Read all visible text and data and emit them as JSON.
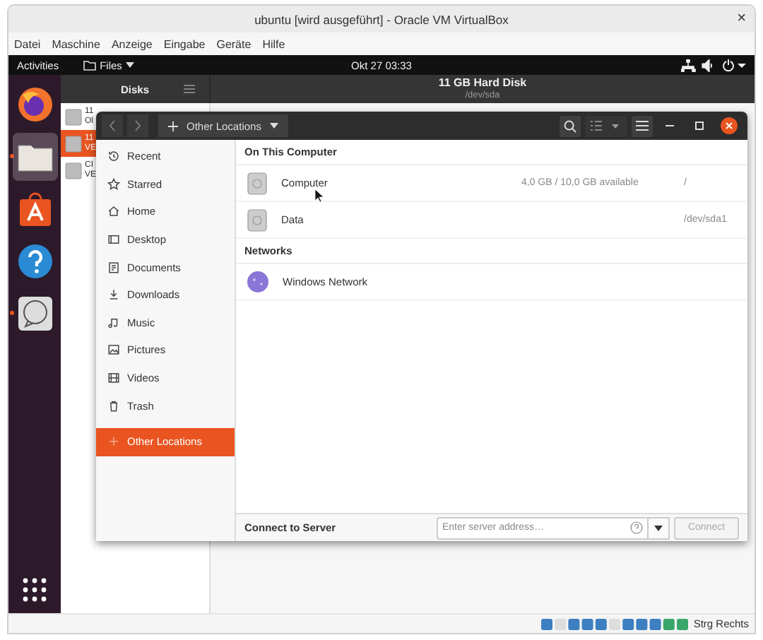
{
  "window": {
    "title": "ubuntu [wird ausgeführt] - Oracle VM VirtualBox",
    "close_glyph": "×"
  },
  "menu": [
    "Datei",
    "Maschine",
    "Anzeige",
    "Eingabe",
    "Geräte",
    "Hilfe"
  ],
  "top_bar": {
    "activities": "Activities",
    "app_menu": "Files",
    "clock": "Okt 27  03:33"
  },
  "dock": [
    {
      "kind": "firefox",
      "running": false,
      "selected": false
    },
    {
      "kind": "files",
      "running": true,
      "selected": true
    },
    {
      "kind": "store",
      "running": false,
      "selected": false
    },
    {
      "kind": "help",
      "running": false,
      "selected": false
    },
    {
      "kind": "chat",
      "running": true,
      "selected": false
    }
  ],
  "disks": {
    "title": "Disks",
    "header_title": "11 GB Hard Disk",
    "header_subtitle": "/dev/sda",
    "items": [
      {
        "title": "11",
        "subtitle": "Ol",
        "selected": false
      },
      {
        "title": "11",
        "subtitle": "VE",
        "selected": true
      },
      {
        "title": "CI",
        "subtitle": "VE",
        "selected": false
      }
    ]
  },
  "files": {
    "location": "Other Locations",
    "sidebar": [
      {
        "label": "Recent",
        "kind": "recent",
        "selected": false
      },
      {
        "label": "Starred",
        "kind": "star",
        "selected": false
      },
      {
        "label": "Home",
        "kind": "home",
        "selected": false
      },
      {
        "label": "Desktop",
        "kind": "desktop",
        "selected": false
      },
      {
        "label": "Documents",
        "kind": "documents",
        "selected": false
      },
      {
        "label": "Downloads",
        "kind": "downloads",
        "selected": false
      },
      {
        "label": "Music",
        "kind": "music",
        "selected": false
      },
      {
        "label": "Pictures",
        "kind": "pictures",
        "selected": false
      },
      {
        "label": "Videos",
        "kind": "videos",
        "selected": false
      },
      {
        "label": "Trash",
        "kind": "trash",
        "selected": false
      },
      {
        "label": "Other Locations",
        "kind": "other",
        "selected": true
      }
    ],
    "sections": [
      {
        "title": "On This Computer",
        "rows": [
          {
            "name": "Computer",
            "kind": "drive",
            "info": "4,0 GB / 10,0 GB available",
            "path": "/"
          },
          {
            "name": "Data",
            "kind": "drive",
            "path": "/dev/sda1"
          }
        ]
      },
      {
        "title": "Networks",
        "rows": [
          {
            "name": "Windows Network",
            "kind": "network"
          }
        ]
      }
    ],
    "connect": {
      "label": "Connect to Server",
      "placeholder": "Enter server address…",
      "button": "Connect",
      "disabled": true
    }
  },
  "status_bar": {
    "text": "Strg Rechts"
  }
}
